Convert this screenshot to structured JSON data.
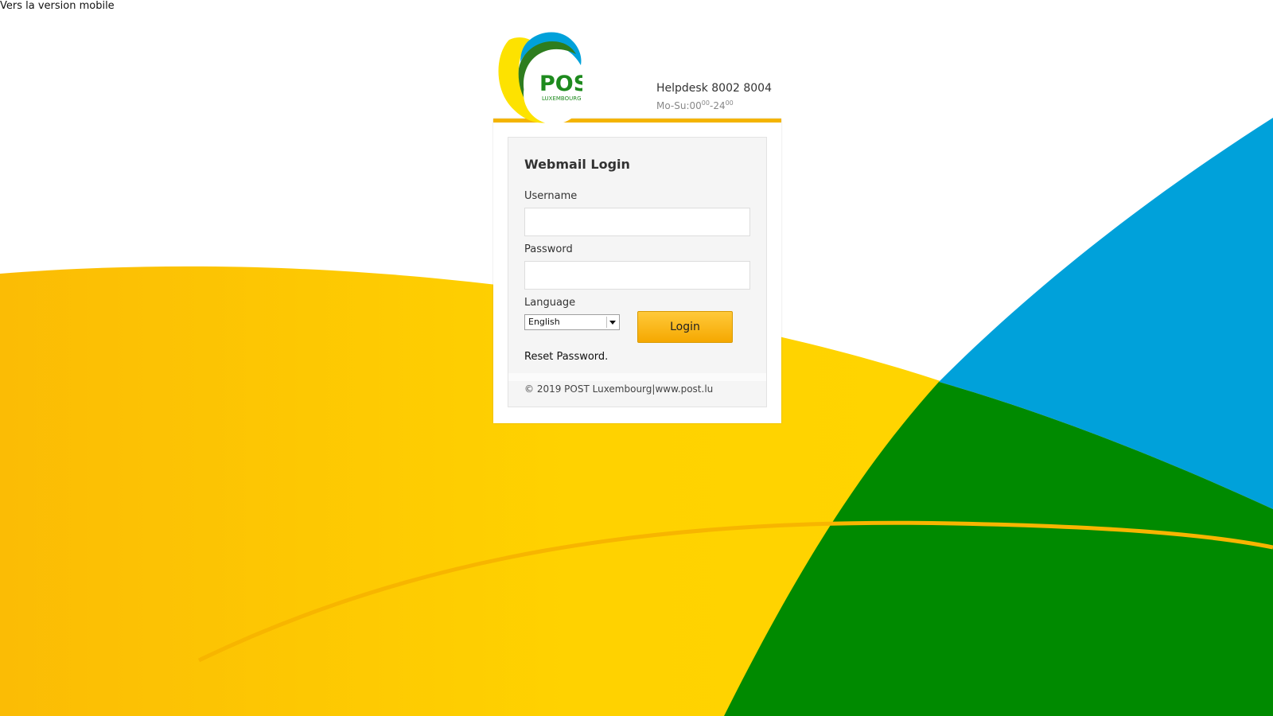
{
  "top_link": {
    "label": "Vers la version mobile"
  },
  "header": {
    "logo_text": "POST",
    "logo_subtext": "LUXEMBOURG",
    "helpdesk": "Helpdesk 8002 8004",
    "hours_prefix": "Mo-Su:00",
    "hours_sup1": "00",
    "hours_mid": "-24",
    "hours_sup2": "00"
  },
  "login": {
    "title": "Webmail Login",
    "username_label": "Username",
    "username_value": "",
    "password_label": "Password",
    "password_value": "",
    "language_label": "Language",
    "language_selected": "English",
    "login_button": "Login",
    "reset_link": "Reset Password.",
    "footer": "© 2019 POST Luxembourg|www.post.lu"
  },
  "colors": {
    "accent_yellow": "#f4b400",
    "brand_green": "#008a00",
    "brand_blue": "#00a1da",
    "button_gradient_top": "#ffc93a",
    "button_gradient_bottom": "#f5a800"
  },
  "icons": {
    "logo": "post-luxembourg-logo-icon",
    "select_arrow": "dropdown-arrow-icon"
  }
}
